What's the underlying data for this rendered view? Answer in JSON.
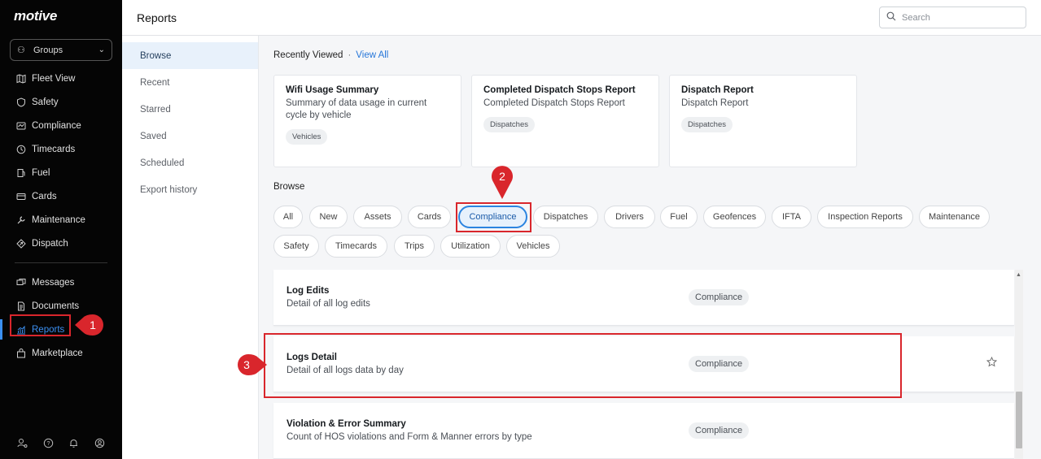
{
  "brand": {
    "logo": "motive"
  },
  "sidebar": {
    "groups_label": "Groups",
    "items": [
      {
        "label": "Fleet View",
        "icon": "map-icon"
      },
      {
        "label": "Safety",
        "icon": "shield-icon"
      },
      {
        "label": "Compliance",
        "icon": "compliance-icon"
      },
      {
        "label": "Timecards",
        "icon": "clock-icon"
      },
      {
        "label": "Fuel",
        "icon": "fuel-icon"
      },
      {
        "label": "Cards",
        "icon": "card-icon"
      },
      {
        "label": "Maintenance",
        "icon": "wrench-icon"
      },
      {
        "label": "Dispatch",
        "icon": "dispatch-icon"
      }
    ],
    "items2": [
      {
        "label": "Messages",
        "icon": "messages-icon"
      },
      {
        "label": "Documents",
        "icon": "document-icon"
      },
      {
        "label": "Reports",
        "icon": "reports-icon",
        "active": true
      },
      {
        "label": "Marketplace",
        "icon": "marketplace-icon"
      }
    ],
    "annotation_1": "1"
  },
  "header": {
    "title": "Reports",
    "search_placeholder": "Search"
  },
  "subnav": {
    "items": [
      "Browse",
      "Recent",
      "Starred",
      "Saved",
      "Scheduled",
      "Export history"
    ],
    "active": "Browse"
  },
  "recently_viewed": {
    "title": "Recently Viewed",
    "view_all": "View All",
    "cards": [
      {
        "title": "Wifi Usage Summary",
        "desc": "Summary of data usage in current cycle by vehicle",
        "tag": "Vehicles"
      },
      {
        "title": "Completed Dispatch Stops Report",
        "desc": "Completed Dispatch Stops Report",
        "tag": "Dispatches"
      },
      {
        "title": "Dispatch Report",
        "desc": "Dispatch Report",
        "tag": "Dispatches"
      }
    ]
  },
  "browse": {
    "title": "Browse",
    "pills_row1": [
      "All",
      "New",
      "Assets",
      "Cards",
      "Compliance",
      "Dispatches",
      "Drivers",
      "Fuel",
      "Geofences",
      "IFTA",
      "Inspection Reports",
      "Maintenance"
    ],
    "pills_row2": [
      "Safety",
      "Timecards",
      "Trips",
      "Utilization",
      "Vehicles"
    ],
    "active": "Compliance",
    "annotation_2": "2"
  },
  "reports": [
    {
      "title": "Log Edits",
      "desc": "Detail of all log edits",
      "tag": "Compliance"
    },
    {
      "title": "Logs Detail",
      "desc": "Detail of all logs data by day",
      "tag": "Compliance"
    },
    {
      "title": "Violation & Error Summary",
      "desc": "Count of HOS violations and Form & Manner errors by type",
      "tag": "Compliance"
    }
  ],
  "annotation_3": "3",
  "colors": {
    "accent": "#2b84e0",
    "highlight": "#d9262c",
    "sidebar_bg": "#050505"
  }
}
